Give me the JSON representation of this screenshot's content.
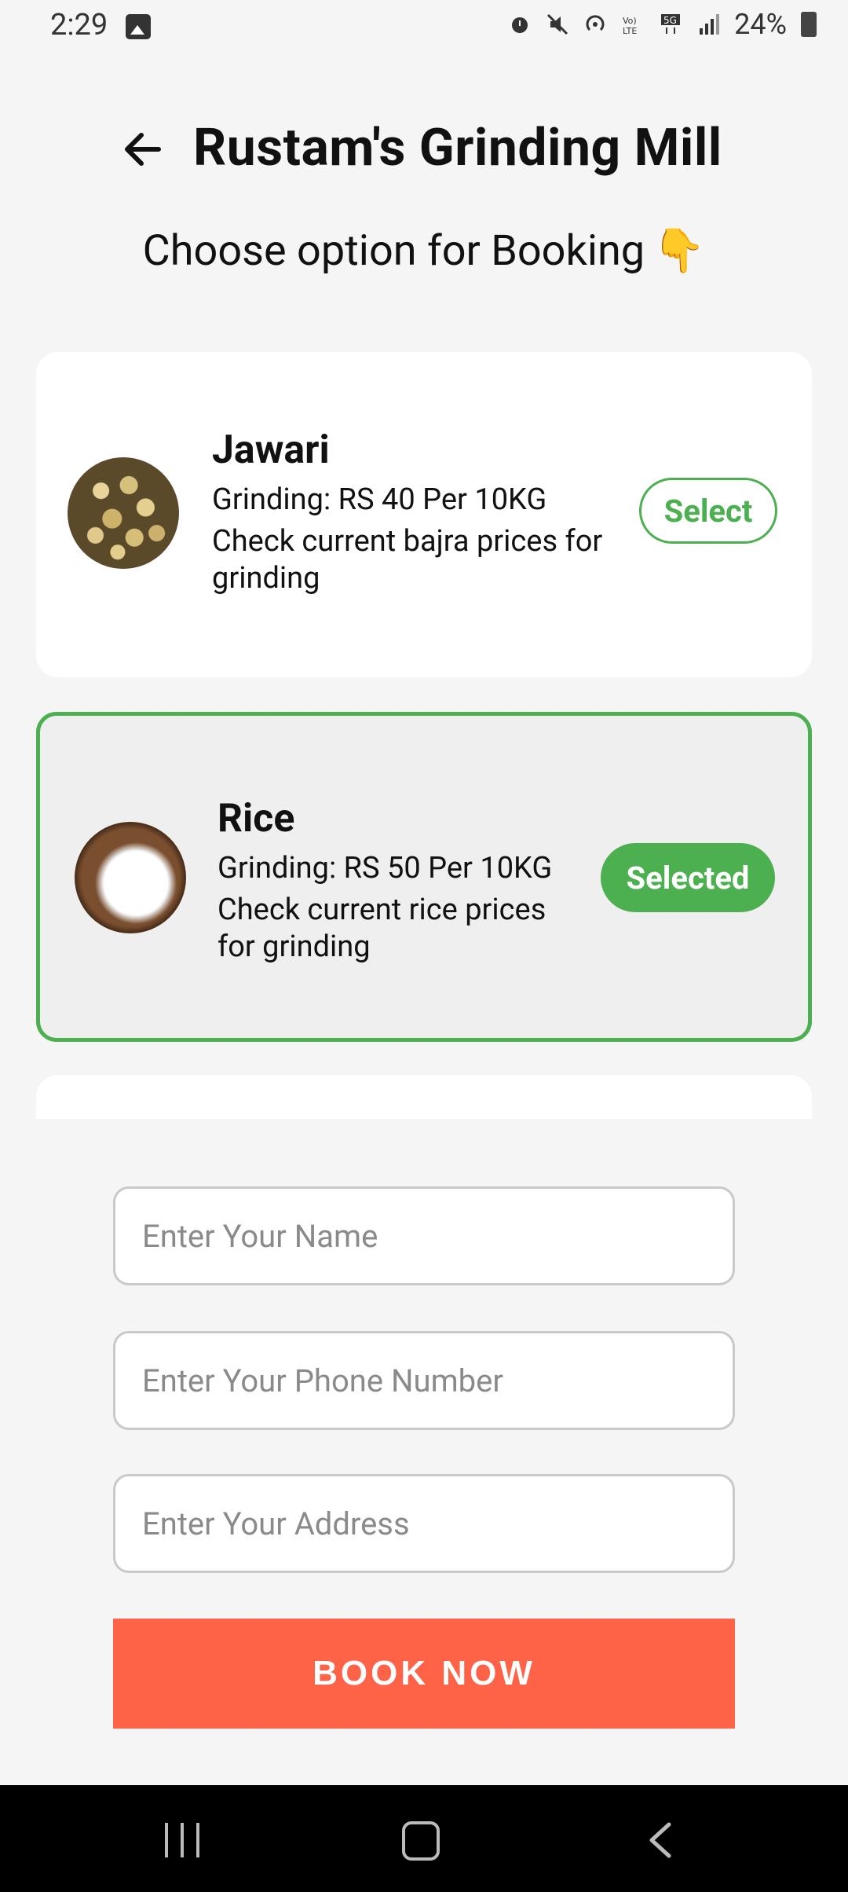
{
  "status_bar": {
    "time": "2:29",
    "battery": "24%",
    "icons": [
      "image-icon",
      "alarm-icon",
      "mute-icon",
      "hotspot-icon",
      "volte-icon",
      "5g-icon",
      "signal-icon",
      "battery-icon"
    ]
  },
  "header": {
    "title": "Rustam's Grinding Mill",
    "back_icon": "arrow-left-icon"
  },
  "subtitle": {
    "text": "Choose option for Booking",
    "emoji": "👇"
  },
  "options": [
    {
      "name": "Jawari",
      "price": "Grinding: RS 40  Per 10KG",
      "description": "Check current bajra prices for grinding",
      "button": "Select",
      "selected": false
    },
    {
      "name": "Rice",
      "price": "Grinding: RS 50 Per 10KG",
      "description": "Check current rice prices for grinding",
      "button": "Selected",
      "selected": true
    }
  ],
  "form": {
    "name_placeholder": "Enter Your Name",
    "phone_placeholder": "Enter Your Phone Number",
    "address_placeholder": "Enter Your Address",
    "submit_label": "BOOK NOW"
  },
  "colors": {
    "accent_green": "#4caf50",
    "book_button": "#ff6347",
    "background": "#f5f5f5"
  }
}
